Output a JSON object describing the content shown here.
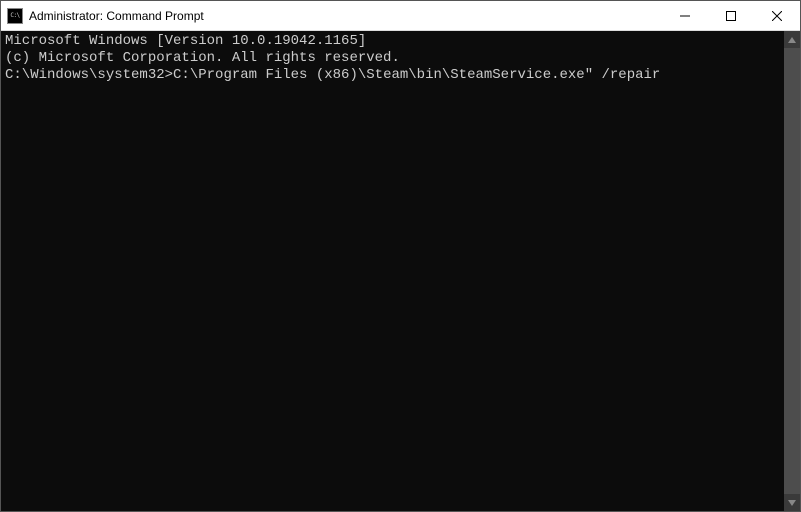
{
  "window": {
    "title": "Administrator: Command Prompt"
  },
  "terminal": {
    "line1": "Microsoft Windows [Version 10.0.19042.1165]",
    "line2": "(c) Microsoft Corporation. All rights reserved.",
    "blank": "",
    "prompt": "C:\\Windows\\system32>",
    "command": "C:\\Program Files (x86)\\Steam\\bin\\SteamService.exe\" /repair"
  }
}
